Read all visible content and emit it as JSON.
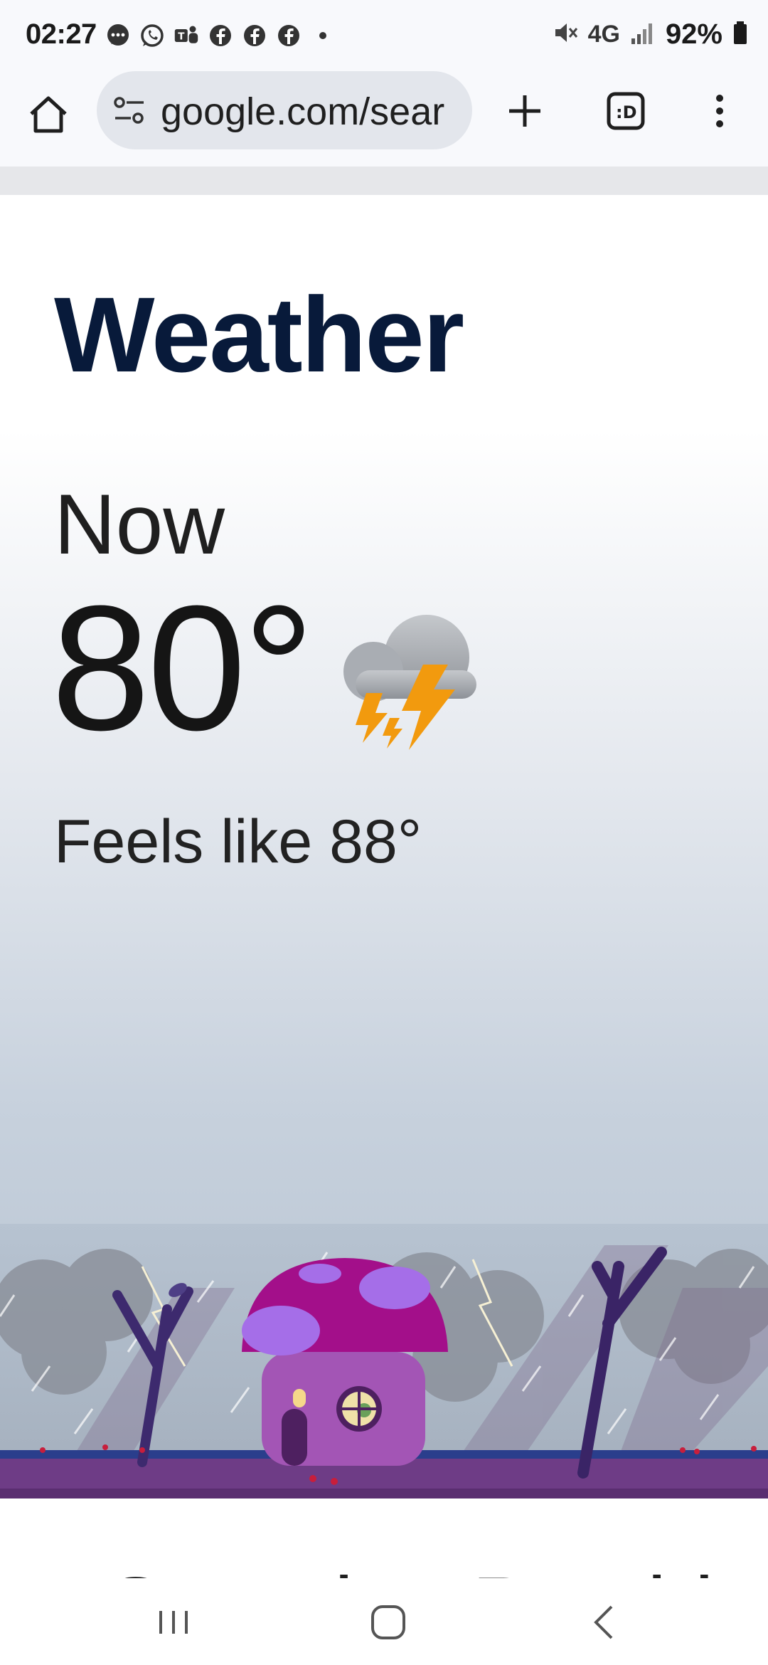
{
  "status_bar": {
    "time": "02:27",
    "network": "4G",
    "battery": "92%"
  },
  "browser": {
    "url": "google.com/sear"
  },
  "weather": {
    "title": "Weather",
    "now_label": "Now",
    "temperature": "80°",
    "condition_icon": "thunderstorm-icon",
    "feels_like": "Feels like 88°"
  },
  "below": {
    "partial_heading": "Sanraine Preciri"
  },
  "colors": {
    "title": "#081a3a",
    "accent_lightning": "#f29a0e"
  }
}
